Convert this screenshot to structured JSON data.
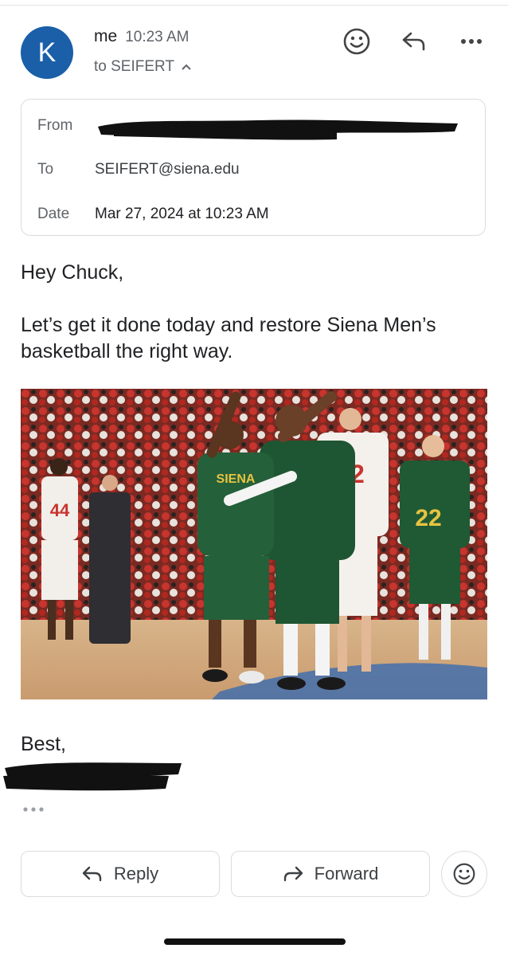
{
  "message": {
    "avatar_letter": "K",
    "sender": "me",
    "time": "10:23 AM",
    "to_summary": "to SEIFERT",
    "accent_color": "#1a5fa8"
  },
  "details": {
    "from_label": "From",
    "from_value_redacted": true,
    "to_label": "To",
    "to_value": "SEIFERT@siena.edu",
    "date_label": "Date",
    "date_value": "Mar 27, 2024 at 10:23 AM"
  },
  "body": {
    "greeting": "Hey Chuck,",
    "line1": "Let’s get it done today and restore Siena Men’s",
    "line2": "basketball the right way.",
    "image_alt": "Siena men's basketball players celebrating on court",
    "jersey_numbers": [
      "44",
      "32",
      "22"
    ],
    "team_wordmark": "SIENA",
    "signoff": "Best,",
    "signature_redacted": true
  },
  "icons": {
    "emoji": "emoji-icon",
    "reply": "reply-icon",
    "more": "more-icon",
    "forward": "forward-icon"
  },
  "actions": {
    "reply_label": "Reply",
    "forward_label": "Forward"
  }
}
